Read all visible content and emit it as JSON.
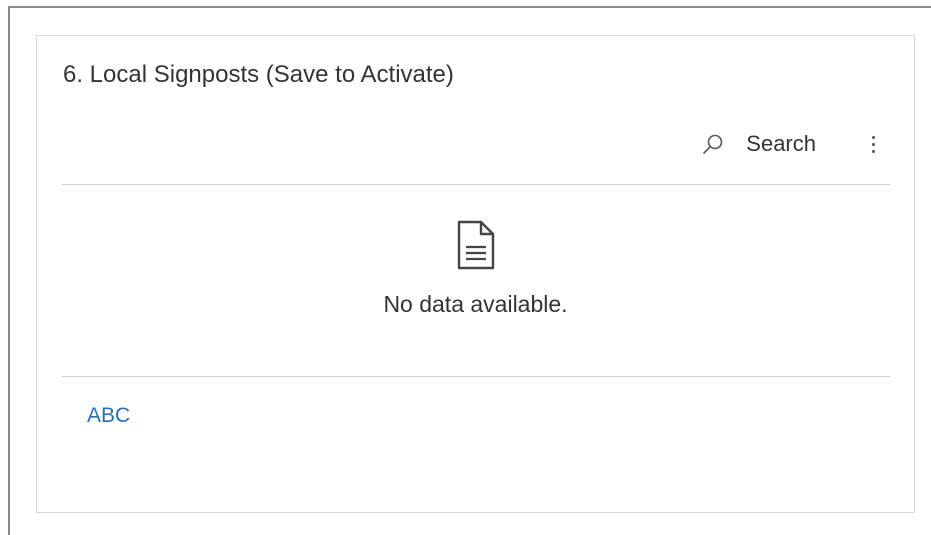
{
  "card": {
    "title": "6. Local Signposts (Save to Activate)"
  },
  "toolbar": {
    "search_label": "Search",
    "search_icon": "search-icon",
    "more_icon": "more-vertical-icon"
  },
  "empty_state": {
    "icon": "document-icon",
    "message": "No data available."
  },
  "footer": {
    "link_label": "ABC"
  },
  "colors": {
    "link": "#2a6fb4",
    "text": "#333333",
    "divider": "#d4d4d4"
  }
}
